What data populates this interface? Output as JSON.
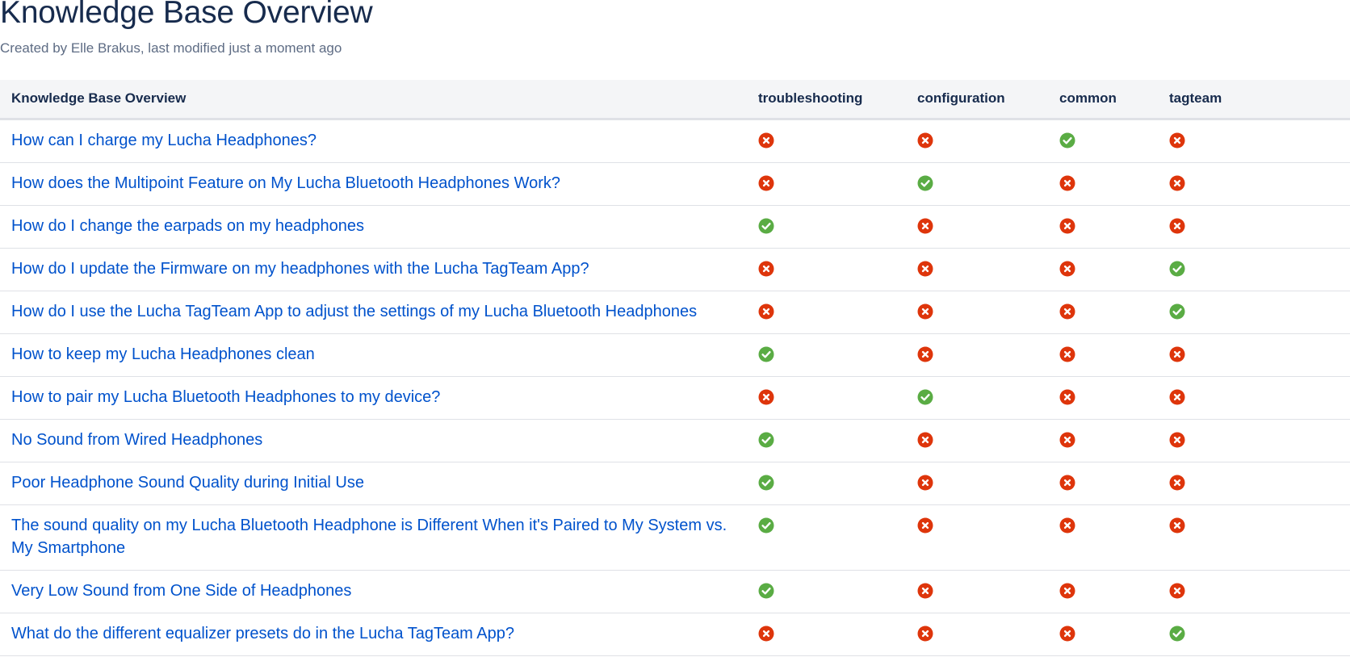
{
  "page": {
    "title": "Knowledge Base Overview",
    "byline": "Created by Elle Brakus, last modified just a moment ago"
  },
  "colors": {
    "check": "#5aac44",
    "cross": "#de350b",
    "link": "#0052cc",
    "header_bg": "#f4f5f7"
  },
  "icons": {
    "yes": "check-circle-icon",
    "no": "cross-circle-icon"
  },
  "table": {
    "headers": [
      "Knowledge Base Overview",
      "troubleshooting",
      "configuration",
      "common",
      "tagteam"
    ],
    "rows": [
      {
        "title": "How can I charge my Lucha Headphones?",
        "troubleshooting": false,
        "configuration": false,
        "common": true,
        "tagteam": false
      },
      {
        "title": "How does the Multipoint Feature on My Lucha Bluetooth Headphones Work?",
        "troubleshooting": false,
        "configuration": true,
        "common": false,
        "tagteam": false
      },
      {
        "title": "How do I change the earpads on my headphones",
        "troubleshooting": true,
        "configuration": false,
        "common": false,
        "tagteam": false
      },
      {
        "title": "How do I update the Firmware on my headphones with the Lucha TagTeam App?",
        "troubleshooting": false,
        "configuration": false,
        "common": false,
        "tagteam": true
      },
      {
        "title": "How do I use the Lucha TagTeam App to adjust the settings of my Lucha Bluetooth Headphones",
        "troubleshooting": false,
        "configuration": false,
        "common": false,
        "tagteam": true
      },
      {
        "title": "How to keep my Lucha Headphones clean",
        "troubleshooting": true,
        "configuration": false,
        "common": false,
        "tagteam": false
      },
      {
        "title": "How to pair my Lucha Bluetooth Headphones to my device?",
        "troubleshooting": false,
        "configuration": true,
        "common": false,
        "tagteam": false
      },
      {
        "title": "No Sound from Wired Headphones",
        "troubleshooting": true,
        "configuration": false,
        "common": false,
        "tagteam": false
      },
      {
        "title": "Poor Headphone Sound Quality during Initial Use",
        "troubleshooting": true,
        "configuration": false,
        "common": false,
        "tagteam": false
      },
      {
        "title": "The sound quality on my Lucha Bluetooth Headphone is Different When it's Paired to My System vs. My Smartphone",
        "troubleshooting": true,
        "configuration": false,
        "common": false,
        "tagteam": false
      },
      {
        "title": "Very Low Sound from One Side of Headphones",
        "troubleshooting": true,
        "configuration": false,
        "common": false,
        "tagteam": false
      },
      {
        "title": "What do the different equalizer presets do in the Lucha TagTeam App?",
        "troubleshooting": false,
        "configuration": false,
        "common": false,
        "tagteam": true
      }
    ]
  }
}
